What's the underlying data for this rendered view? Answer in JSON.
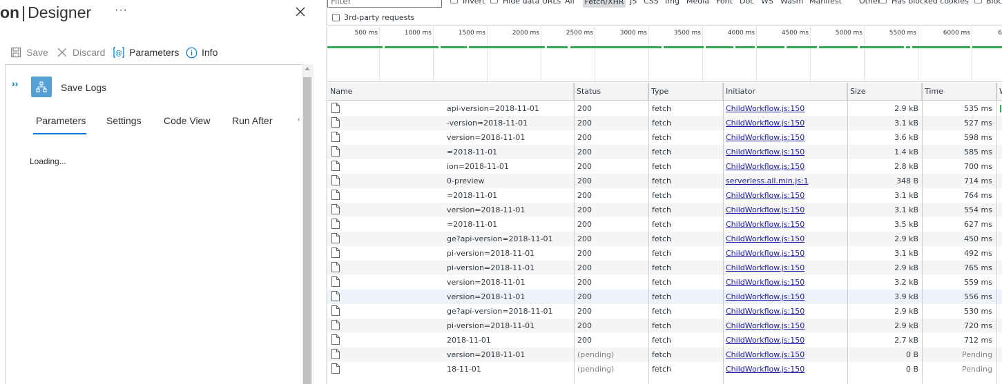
{
  "designer": {
    "title_bold": "on",
    "title_sep": "|",
    "title_rest": "Designer",
    "more_label": "···",
    "toolbar": {
      "save": "Save",
      "discard": "Discard",
      "parameters": "Parameters",
      "info": "Info"
    },
    "card": {
      "title": "Save Logs",
      "expand_glyph": "››"
    },
    "tabs": [
      "Parameters",
      "Settings",
      "Code View",
      "Run After"
    ],
    "active_tab": "Parameters",
    "tab_overflow": "‹",
    "loading": "Loading..."
  },
  "devtools": {
    "filter_placeholder": "Filter",
    "invert": "Invert",
    "hide_data_urls": "Hide data URLs",
    "type_filters": [
      "All",
      "Fetch/XHR",
      "JS",
      "CSS",
      "Img",
      "Media",
      "Font",
      "Doc",
      "WS",
      "Wasm",
      "Manifest",
      "Other"
    ],
    "active_type_filter": "Fetch/XHR",
    "has_blocked_cookies": "Has blocked cookies",
    "blocked_requests": "Bloc",
    "third_party": "3rd-party requests",
    "timeline_ticks": [
      "500 ms",
      "1000 ms",
      "1500 ms",
      "2000 ms",
      "2500 ms",
      "3000 ms",
      "3500 ms",
      "4000 ms",
      "4500 ms",
      "5000 ms",
      "5500 ms",
      "6000 ms",
      "6"
    ],
    "columns": {
      "name": "Name",
      "status": "Status",
      "type": "Type",
      "initiator": "Initiator",
      "size": "Size",
      "time": "Time",
      "waterfall": "W"
    },
    "rows": [
      {
        "name": "api-version=2018-11-01",
        "status": "200",
        "type": "fetch",
        "initiator": "ChildWorkflow.js:150",
        "size": "2.9 kB",
        "time": "535 ms"
      },
      {
        "name": "-version=2018-11-01",
        "status": "200",
        "type": "fetch",
        "initiator": "ChildWorkflow.js:150",
        "size": "3.1 kB",
        "time": "527 ms"
      },
      {
        "name": "version=2018-11-01",
        "status": "200",
        "type": "fetch",
        "initiator": "ChildWorkflow.js:150",
        "size": "3.6 kB",
        "time": "598 ms"
      },
      {
        "name": "=2018-11-01",
        "status": "200",
        "type": "fetch",
        "initiator": "ChildWorkflow.js:150",
        "size": "1.4 kB",
        "time": "585 ms"
      },
      {
        "name": "ion=2018-11-01",
        "status": "200",
        "type": "fetch",
        "initiator": "ChildWorkflow.js:150",
        "size": "2.8 kB",
        "time": "700 ms"
      },
      {
        "name": "0-preview",
        "status": "200",
        "type": "fetch",
        "initiator": "serverless.all.min.js:1",
        "size": "348 B",
        "time": "714 ms"
      },
      {
        "name": "=2018-11-01",
        "status": "200",
        "type": "fetch",
        "initiator": "ChildWorkflow.js:150",
        "size": "3.1 kB",
        "time": "764 ms"
      },
      {
        "name": "version=2018-11-01",
        "status": "200",
        "type": "fetch",
        "initiator": "ChildWorkflow.js:150",
        "size": "3.1 kB",
        "time": "554 ms"
      },
      {
        "name": "=2018-11-01",
        "status": "200",
        "type": "fetch",
        "initiator": "ChildWorkflow.js:150",
        "size": "3.5 kB",
        "time": "627 ms"
      },
      {
        "name": "ge?api-version=2018-11-01",
        "status": "200",
        "type": "fetch",
        "initiator": "ChildWorkflow.js:150",
        "size": "2.9 kB",
        "time": "450 ms"
      },
      {
        "name": "pi-version=2018-11-01",
        "status": "200",
        "type": "fetch",
        "initiator": "ChildWorkflow.js:150",
        "size": "3.1 kB",
        "time": "492 ms"
      },
      {
        "name": "pi-version=2018-11-01",
        "status": "200",
        "type": "fetch",
        "initiator": "ChildWorkflow.js:150",
        "size": "2.9 kB",
        "time": "765 ms"
      },
      {
        "name": "version=2018-11-01",
        "status": "200",
        "type": "fetch",
        "initiator": "ChildWorkflow.js:150",
        "size": "3.2 kB",
        "time": "559 ms"
      },
      {
        "name": "version=2018-11-01",
        "status": "200",
        "type": "fetch",
        "initiator": "ChildWorkflow.js:150",
        "size": "3.9 kB",
        "time": "556 ms"
      },
      {
        "name": "ge?api-version=2018-11-01",
        "status": "200",
        "type": "fetch",
        "initiator": "ChildWorkflow.js:150",
        "size": "2.9 kB",
        "time": "530 ms"
      },
      {
        "name": "pi-version=2018-11-01",
        "status": "200",
        "type": "fetch",
        "initiator": "ChildWorkflow.js:150",
        "size": "2.9 kB",
        "time": "720 ms"
      },
      {
        "name": "2018-11-01",
        "status": "200",
        "type": "fetch",
        "initiator": "ChildWorkflow.js:150",
        "size": "2.7 kB",
        "time": "712 ms"
      },
      {
        "name": "version=2018-11-01",
        "status": "(pending)",
        "type": "fetch",
        "initiator": "ChildWorkflow.js:150",
        "size": "0 B",
        "time": "Pending"
      },
      {
        "name": "18-11-01",
        "status": "(pending)",
        "type": "fetch",
        "initiator": "ChildWorkflow.js:150",
        "size": "0 B",
        "time": "Pending"
      }
    ]
  },
  "colors": {
    "accent": "#0078d4",
    "network_bar": "#34a853",
    "link": "#1a1aa6"
  }
}
